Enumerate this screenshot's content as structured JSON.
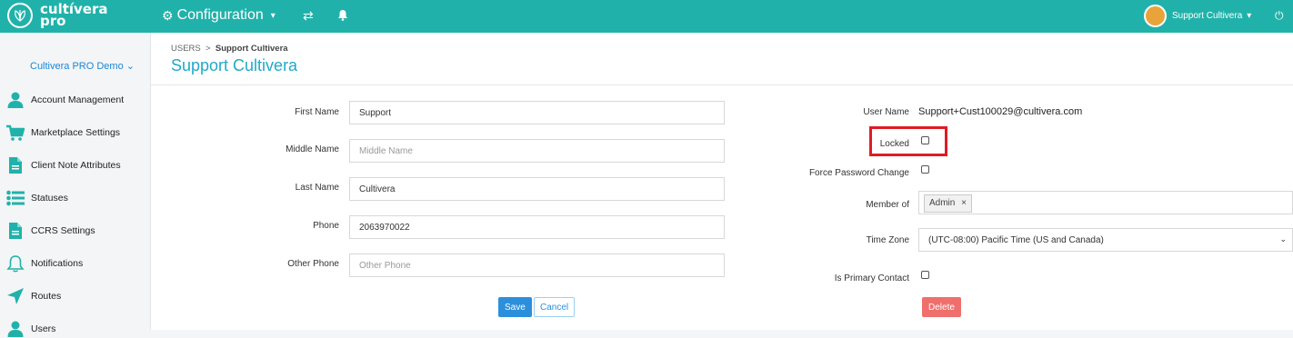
{
  "topbar": {
    "logo_line1": "cultívera",
    "logo_line2": "pro",
    "config_label": "Configuration",
    "user_name": "Support Cultivera"
  },
  "sidebar": {
    "org": "Cultivera PRO Demo",
    "items": [
      {
        "label": "Account Management",
        "icon": "user-icon"
      },
      {
        "label": "Marketplace Settings",
        "icon": "cart-icon"
      },
      {
        "label": "Client Note Attributes",
        "icon": "document-icon"
      },
      {
        "label": "Statuses",
        "icon": "list-icon"
      },
      {
        "label": "CCRS Settings",
        "icon": "document-icon"
      },
      {
        "label": "Notifications",
        "icon": "bell-icon"
      },
      {
        "label": "Routes",
        "icon": "navigation-arrow-icon"
      },
      {
        "label": "Users",
        "icon": "user-icon"
      }
    ]
  },
  "breadcrumb": {
    "root": "USERS",
    "separator": ">",
    "current": "Support Cultivera"
  },
  "page_title": "Support Cultivera",
  "form_left": {
    "first_name": {
      "label": "First Name",
      "value": "Support"
    },
    "middle_name": {
      "label": "Middle Name",
      "placeholder": "Middle Name"
    },
    "last_name": {
      "label": "Last Name",
      "value": "Cultivera"
    },
    "phone": {
      "label": "Phone",
      "value": "2063970022"
    },
    "other_phone": {
      "label": "Other Phone",
      "placeholder": "Other Phone"
    }
  },
  "form_right": {
    "user_name": {
      "label": "User Name",
      "value": "Support+Cust100029@cultivera.com"
    },
    "locked": {
      "label": "Locked",
      "checked": false
    },
    "force_password_change": {
      "label": "Force Password Change",
      "checked": false
    },
    "member_of": {
      "label": "Member of",
      "tags": [
        "Admin"
      ]
    },
    "time_zone": {
      "label": "Time Zone",
      "value": "(UTC-08:00) Pacific Time (US and Canada)"
    },
    "is_primary_contact": {
      "label": "Is Primary Contact",
      "checked": false
    }
  },
  "buttons": {
    "save": "Save",
    "cancel": "Cancel",
    "delete": "Delete"
  },
  "colors": {
    "topbar": "#20b2aa",
    "title": "#20a9c9",
    "save": "#2c8fdc",
    "delete": "#ef6f6c",
    "highlight": "#e01b24"
  }
}
